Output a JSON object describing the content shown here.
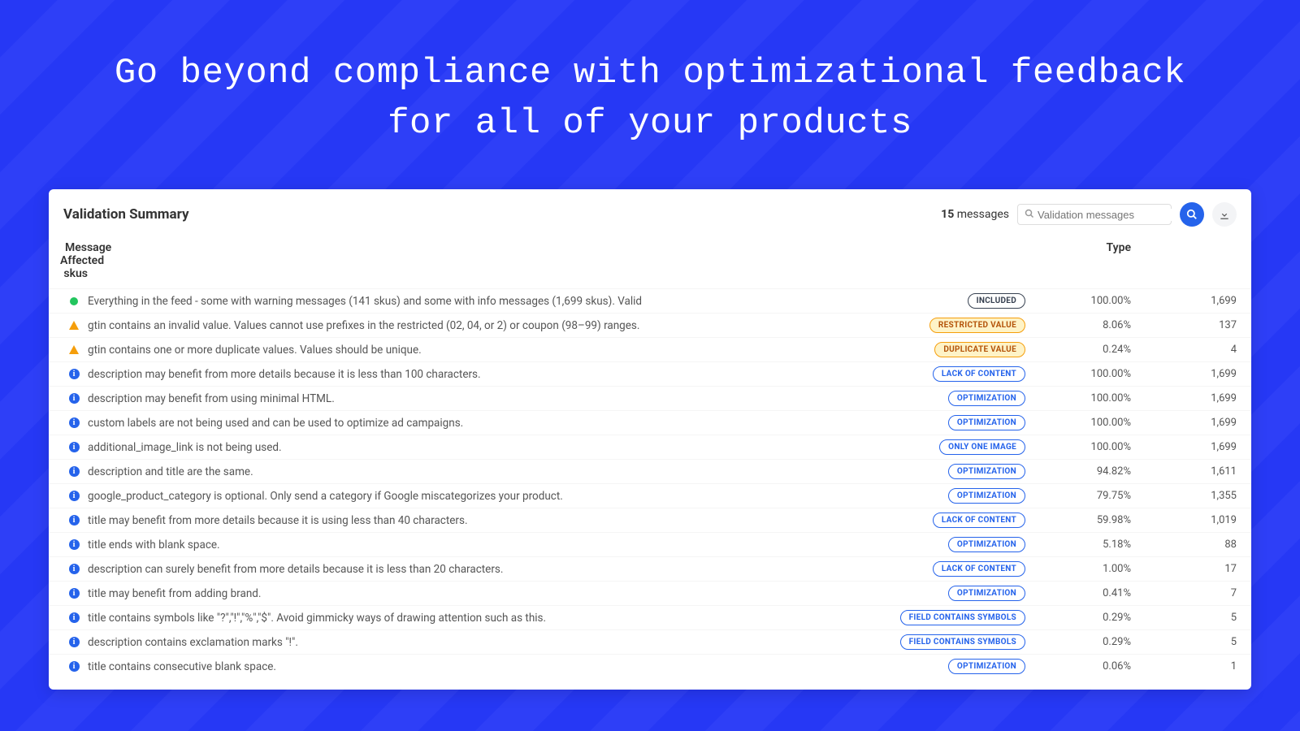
{
  "hero": {
    "title": "Go beyond compliance with optimizational feedback for all of your products"
  },
  "panel": {
    "title": "Validation Summary",
    "message_count": "15",
    "message_count_label": "messages",
    "search_placeholder": "Validation messages"
  },
  "columns": {
    "message": "Message",
    "type": "Type",
    "affected": "Affected skus"
  },
  "badge_labels": {
    "included": "INCLUDED",
    "restricted": "RESTRICTED VALUE",
    "duplicate": "DUPLICATE VALUE",
    "lack": "LACK OF CONTENT",
    "opt": "OPTIMIZATION",
    "oneimg": "ONLY ONE IMAGE",
    "symbols": "FIELD CONTAINS SYMBOLS"
  },
  "rows": [
    {
      "icon": "ok",
      "msg": "Everything in the feed - some with warning messages (141 skus) and some with info messages (1,699 skus). Valid",
      "badge": "included",
      "pct": "100.00%",
      "sku": "1,699"
    },
    {
      "icon": "warn",
      "msg": "gtin contains an invalid value. Values cannot use prefixes in the restricted (02, 04, or 2) or coupon (98–99) ranges.",
      "badge": "restricted",
      "pct": "8.06%",
      "sku": "137"
    },
    {
      "icon": "warn",
      "msg": "gtin contains one or more duplicate values. Values should be unique.",
      "badge": "duplicate",
      "pct": "0.24%",
      "sku": "4"
    },
    {
      "icon": "info",
      "msg": "description may benefit from more details because it is less than 100 characters.",
      "badge": "lack",
      "pct": "100.00%",
      "sku": "1,699"
    },
    {
      "icon": "info",
      "msg": "description may benefit from using minimal HTML.",
      "badge": "opt",
      "pct": "100.00%",
      "sku": "1,699"
    },
    {
      "icon": "info",
      "msg": "custom labels are not being used and can be used to optimize ad campaigns.",
      "badge": "opt",
      "pct": "100.00%",
      "sku": "1,699"
    },
    {
      "icon": "info",
      "msg": "additional_image_link is not being used.",
      "badge": "oneimg",
      "pct": "100.00%",
      "sku": "1,699"
    },
    {
      "icon": "info",
      "msg": "description and title are the same.",
      "badge": "opt",
      "pct": "94.82%",
      "sku": "1,611"
    },
    {
      "icon": "info",
      "msg": "google_product_category is optional. Only send a category if Google miscategorizes your product.",
      "badge": "opt",
      "pct": "79.75%",
      "sku": "1,355"
    },
    {
      "icon": "info",
      "msg": "title may benefit from more details because it is using less than 40 characters.",
      "badge": "lack",
      "pct": "59.98%",
      "sku": "1,019"
    },
    {
      "icon": "info",
      "msg": "title ends with blank space.",
      "badge": "opt",
      "pct": "5.18%",
      "sku": "88"
    },
    {
      "icon": "info",
      "msg": "description can surely benefit from more details because it is less than 20 characters.",
      "badge": "lack",
      "pct": "1.00%",
      "sku": "17"
    },
    {
      "icon": "info",
      "msg": "title may benefit from adding brand.",
      "badge": "opt",
      "pct": "0.41%",
      "sku": "7"
    },
    {
      "icon": "info",
      "msg": "title contains symbols like \"?\",\"!\",\"%\",\"$\". Avoid gimmicky ways of drawing attention such as this.",
      "badge": "symbols",
      "pct": "0.29%",
      "sku": "5"
    },
    {
      "icon": "info",
      "msg": "description contains exclamation marks \"!\".",
      "badge": "symbols",
      "pct": "0.29%",
      "sku": "5"
    },
    {
      "icon": "info",
      "msg": "title contains consecutive blank space.",
      "badge": "opt",
      "pct": "0.06%",
      "sku": "1"
    }
  ]
}
